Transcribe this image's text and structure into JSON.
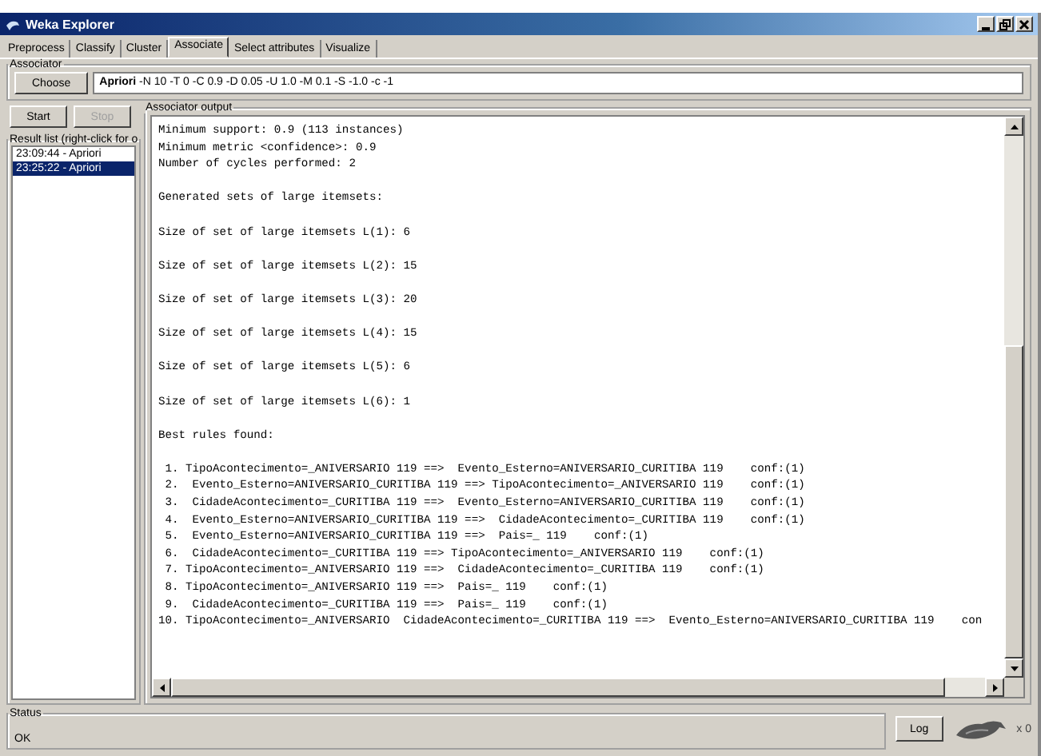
{
  "window": {
    "title": "Weka Explorer"
  },
  "tabs": [
    {
      "label": "Preprocess",
      "selected": false
    },
    {
      "label": "Classify",
      "selected": false
    },
    {
      "label": "Cluster",
      "selected": false
    },
    {
      "label": "Associate",
      "selected": true
    },
    {
      "label": "Select attributes",
      "selected": false
    },
    {
      "label": "Visualize",
      "selected": false
    }
  ],
  "associator": {
    "title": "Associator",
    "button": "Choose",
    "name": "Apriori",
    "options": "-N 10 -T 0 -C 0.9 -D 0.05 -U 1.0 -M 0.1 -S -1.0 -c -1"
  },
  "controls": [
    {
      "label": "Start",
      "disabled": false
    },
    {
      "label": "Stop",
      "disabled": true
    }
  ],
  "result_list": {
    "title": "Result list (right-click for o",
    "items": [
      {
        "label": "23:09:44 - Apriori",
        "selected": false
      },
      {
        "label": "23:25:22 - Apriori",
        "selected": true
      }
    ]
  },
  "output": {
    "title": "Associator output",
    "blocks": [
      [
        "Minimum support: 0.9 (113 instances)",
        "Minimum metric <confidence>: 0.9",
        "Number of cycles performed: 2"
      ],
      [
        "Generated sets of large itemsets:"
      ],
      [
        "Size of set of large itemsets L(1): 6"
      ],
      [
        "Size of set of large itemsets L(2): 15"
      ],
      [
        "Size of set of large itemsets L(3): 20"
      ],
      [
        "Size of set of large itemsets L(4): 15"
      ],
      [
        "Size of set of large itemsets L(5): 6"
      ],
      [
        "Size of set of large itemsets L(6): 1"
      ],
      [
        "Best rules found:"
      ],
      [
        " 1. TipoAcontecimento=_ANIVERSARIO 119 ==>  Evento_Esterno=ANIVERSARIO_CURITIBA 119    conf:(1)",
        " 2.  Evento_Esterno=ANIVERSARIO_CURITIBA 119 ==> TipoAcontecimento=_ANIVERSARIO 119    conf:(1)",
        " 3.  CidadeAcontecimento=_CURITIBA 119 ==>  Evento_Esterno=ANIVERSARIO_CURITIBA 119    conf:(1)",
        " 4.  Evento_Esterno=ANIVERSARIO_CURITIBA 119 ==>  CidadeAcontecimento=_CURITIBA 119    conf:(1)",
        " 5.  Evento_Esterno=ANIVERSARIO_CURITIBA 119 ==>  Pais=_ 119    conf:(1)",
        " 6.  CidadeAcontecimento=_CURITIBA 119 ==> TipoAcontecimento=_ANIVERSARIO 119    conf:(1)",
        " 7. TipoAcontecimento=_ANIVERSARIO 119 ==>  CidadeAcontecimento=_CURITIBA 119    conf:(1)",
        " 8. TipoAcontecimento=_ANIVERSARIO 119 ==>  Pais=_ 119    conf:(1)",
        " 9.  CidadeAcontecimento=_CURITIBA 119 ==>  Pais=_ 119    conf:(1)",
        "10. TipoAcontecimento=_ANIVERSARIO  CidadeAcontecimento=_CURITIBA 119 ==>  Evento_Esterno=ANIVERSARIO_CURITIBA 119    con"
      ]
    ]
  },
  "status": {
    "title": "Status",
    "message": "OK",
    "log_button": "Log",
    "count": "x 0"
  }
}
